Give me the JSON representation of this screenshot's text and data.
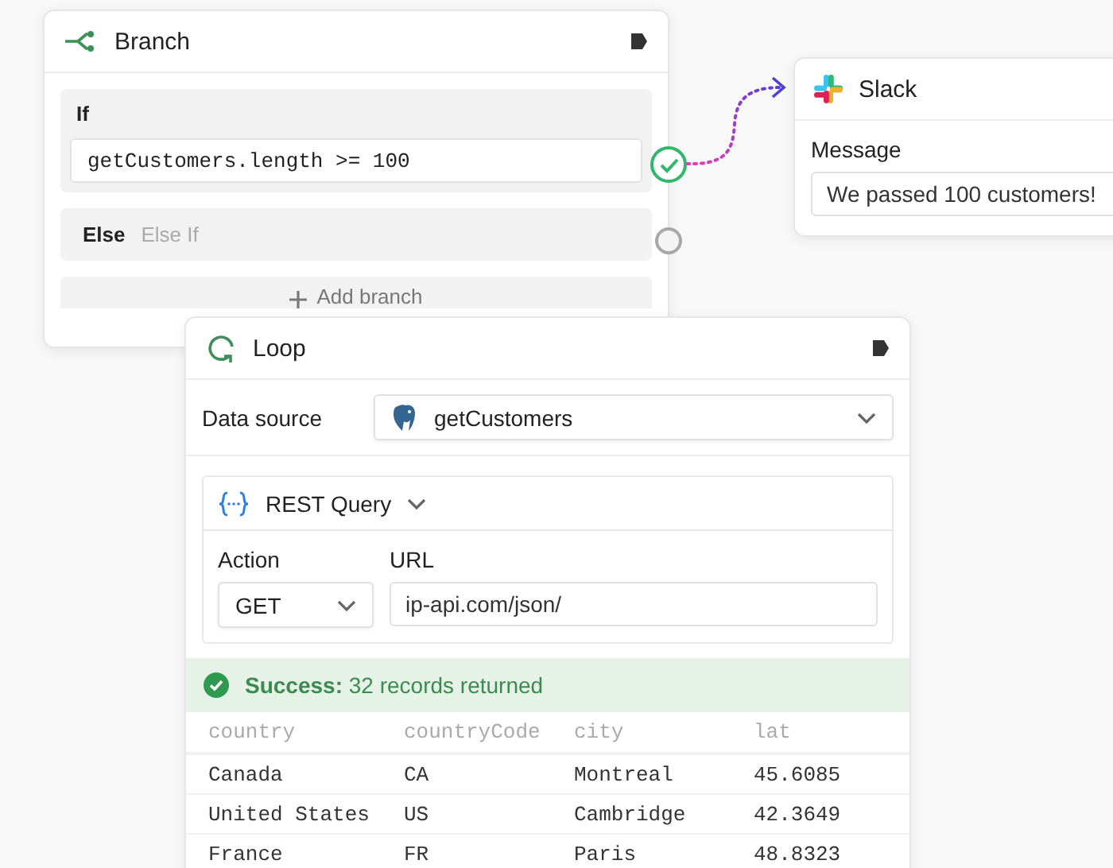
{
  "branch_node": {
    "title": "Branch",
    "if_label": "If",
    "condition": "getCustomers.length >= 100",
    "condition_passed": true,
    "else_label": "Else",
    "else_if_label": "Else If",
    "else_passed": false,
    "add_branch": "Add branch"
  },
  "slack_node": {
    "title": "Slack",
    "message_label": "Message",
    "message": "We passed 100 customers!"
  },
  "loop_node": {
    "title": "Loop",
    "data_source_label": "Data source",
    "data_source": "getCustomers",
    "query_type": "REST Query",
    "action_label": "Action",
    "action": "GET",
    "url_label": "URL",
    "url": "ip-api.com/json/",
    "status": {
      "kind": "success",
      "message": "**Success:** 32 records returned"
    },
    "table": {
      "columns": [
        "country",
        "countryCode",
        "city",
        "lat"
      ],
      "rows": [
        [
          "Canada",
          "CA",
          "Montreal",
          "45.6085"
        ],
        [
          "United States",
          "US",
          "Cambridge",
          "42.3649"
        ],
        [
          "France",
          "FR",
          "Paris",
          "48.8323"
        ]
      ]
    }
  }
}
